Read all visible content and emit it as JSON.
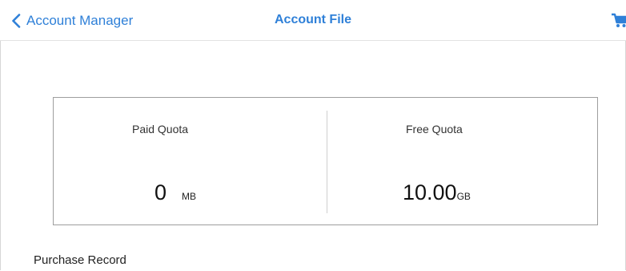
{
  "navbar": {
    "back_label": "Account Manager",
    "title": "Account File",
    "back_icon": "chevron-left-icon",
    "cart_icon": "cart-icon",
    "accent_color": "#2f80d8"
  },
  "quota": {
    "paid": {
      "label": "Paid Quota",
      "value": "0",
      "unit": "MB"
    },
    "free": {
      "label": "Free Quota",
      "value": "10.00",
      "unit": "GB"
    }
  },
  "purchase_record": {
    "title": "Purchase Record"
  }
}
